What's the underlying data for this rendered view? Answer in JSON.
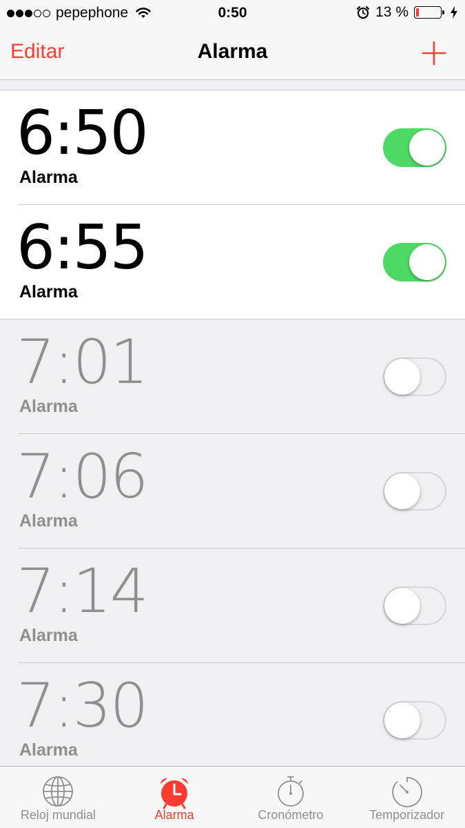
{
  "status_bar": {
    "carrier": "pepephone",
    "time": "0:50",
    "battery_text": "13 %",
    "battery_level": 0.13,
    "signal_filled": 3,
    "signal_total": 5
  },
  "nav": {
    "edit_label": "Editar",
    "title": "Alarma",
    "add_icon": "plus-icon"
  },
  "alarms": [
    {
      "time": "6:50",
      "label": "Alarma",
      "enabled": true
    },
    {
      "time": "6:55",
      "label": "Alarma",
      "enabled": true
    },
    {
      "time": "7:01",
      "label": "Alarma",
      "enabled": false
    },
    {
      "time": "7:06",
      "label": "Alarma",
      "enabled": false
    },
    {
      "time": "7:14",
      "label": "Alarma",
      "enabled": false
    },
    {
      "time": "7:30",
      "label": "Alarma",
      "enabled": false
    }
  ],
  "tabs": [
    {
      "label": "Reloj mundial",
      "icon": "globe-icon",
      "active": false
    },
    {
      "label": "Alarma",
      "icon": "alarm-clock-icon",
      "active": true
    },
    {
      "label": "Cronómetro",
      "icon": "stopwatch-icon",
      "active": false
    },
    {
      "label": "Temporizador",
      "icon": "timer-icon",
      "active": false
    }
  ],
  "colors": {
    "accent": "#ff3b30",
    "toggle_on": "#4cd964",
    "inactive_text": "#8e8e93",
    "background": "#efeff4"
  }
}
